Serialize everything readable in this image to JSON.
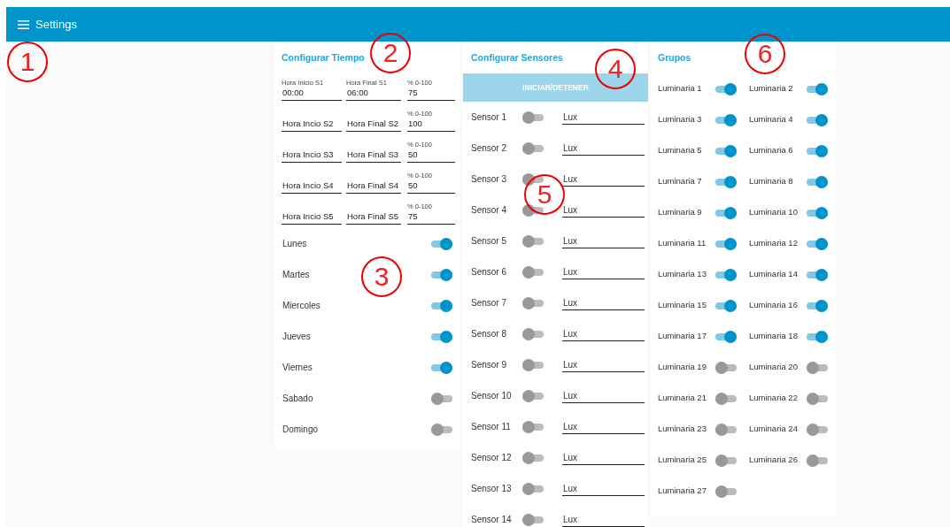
{
  "header": {
    "title": "Settings"
  },
  "time_card": {
    "title": "Configurar Tiempo",
    "slots": [
      {
        "start": {
          "label": "Hora Inicio S1",
          "value": "00:00"
        },
        "end": {
          "label": "Hora Final S1",
          "value": "06:00"
        },
        "percent": {
          "label": "% 0-100",
          "value": "75"
        }
      },
      {
        "start": {
          "placeholder": "Hora Incio S2"
        },
        "end": {
          "placeholder": "Hora Final S2"
        },
        "percent": {
          "label": "% 0-100",
          "value": "100"
        }
      },
      {
        "start": {
          "placeholder": "Hora Incio S3"
        },
        "end": {
          "placeholder": "Hora Final S3"
        },
        "percent": {
          "label": "% 0-100",
          "value": "50"
        }
      },
      {
        "start": {
          "placeholder": "Hora Incio S4"
        },
        "end": {
          "placeholder": "Hora Final S4"
        },
        "percent": {
          "label": "% 0-100",
          "value": "50"
        }
      },
      {
        "start": {
          "placeholder": "Hora Incio S5"
        },
        "end": {
          "placeholder": "Hora Final S5"
        },
        "percent": {
          "label": "% 0-100",
          "value": "75"
        }
      }
    ],
    "days": [
      {
        "label": "Lunes",
        "on": true
      },
      {
        "label": "Martes",
        "on": true
      },
      {
        "label": "Miercoles",
        "on": true
      },
      {
        "label": "Jueves",
        "on": true
      },
      {
        "label": "Viernes",
        "on": true
      },
      {
        "label": "Sabado",
        "on": false
      },
      {
        "label": "Domingo",
        "on": false
      }
    ]
  },
  "sensor_card": {
    "title": "Configurar Sensores",
    "button": "INICIAR/DETENER",
    "sensors": [
      {
        "label": "Sensor 1",
        "on": false,
        "placeholder": "Lux"
      },
      {
        "label": "Sensor 2",
        "on": false,
        "placeholder": "Lux"
      },
      {
        "label": "Sensor 3",
        "on": false,
        "placeholder": "Lux"
      },
      {
        "label": "Sensor 4",
        "on": false,
        "placeholder": "Lux"
      },
      {
        "label": "Sensor 5",
        "on": false,
        "placeholder": "Lux"
      },
      {
        "label": "Sensor 6",
        "on": false,
        "placeholder": "Lux"
      },
      {
        "label": "Sensor 7",
        "on": false,
        "placeholder": "Lux"
      },
      {
        "label": "Sensor 8",
        "on": false,
        "placeholder": "Lux"
      },
      {
        "label": "Sensor 9",
        "on": false,
        "placeholder": "Lux"
      },
      {
        "label": "Sensor 10",
        "on": false,
        "placeholder": "Lux"
      },
      {
        "label": "Sensor 11",
        "on": false,
        "placeholder": "Lux"
      },
      {
        "label": "Sensor 12",
        "on": false,
        "placeholder": "Lux"
      },
      {
        "label": "Sensor 13",
        "on": false,
        "placeholder": "Lux"
      },
      {
        "label": "Sensor 14",
        "on": false,
        "placeholder": "Lux"
      }
    ]
  },
  "groups_card": {
    "title": "Grupos",
    "groups": [
      {
        "label": "Luminaria 1",
        "on": true
      },
      {
        "label": "Luminaria 2",
        "on": true
      },
      {
        "label": "Luminaria 3",
        "on": true
      },
      {
        "label": "Luminaria 4",
        "on": true
      },
      {
        "label": "Luminaria 5",
        "on": true
      },
      {
        "label": "Luminaria 6",
        "on": true
      },
      {
        "label": "Luminaria 7",
        "on": true
      },
      {
        "label": "Luminaria 8",
        "on": true
      },
      {
        "label": "Luminaria 9",
        "on": true
      },
      {
        "label": "Luminaria 10",
        "on": true
      },
      {
        "label": "Luminaria 11",
        "on": true
      },
      {
        "label": "Luminaria 12",
        "on": true
      },
      {
        "label": "Luminaria 13",
        "on": true
      },
      {
        "label": "Luminaria 14",
        "on": true
      },
      {
        "label": "Luminaria 15",
        "on": true
      },
      {
        "label": "Luminaria 16",
        "on": true
      },
      {
        "label": "Luminaria 17",
        "on": true
      },
      {
        "label": "Luminaria 18",
        "on": true
      },
      {
        "label": "Luminaria 19",
        "on": false
      },
      {
        "label": "Luminaria 20",
        "on": false
      },
      {
        "label": "Luminaria 21",
        "on": false
      },
      {
        "label": "Luminaria 22",
        "on": false
      },
      {
        "label": "Luminaria 23",
        "on": false
      },
      {
        "label": "Luminaria 24",
        "on": false
      },
      {
        "label": "Luminaria 25",
        "on": false
      },
      {
        "label": "Luminaria 26",
        "on": false
      },
      {
        "label": "Luminaria 27",
        "on": false
      }
    ]
  },
  "callouts": [
    "1",
    "2",
    "3",
    "4",
    "5",
    "6"
  ]
}
